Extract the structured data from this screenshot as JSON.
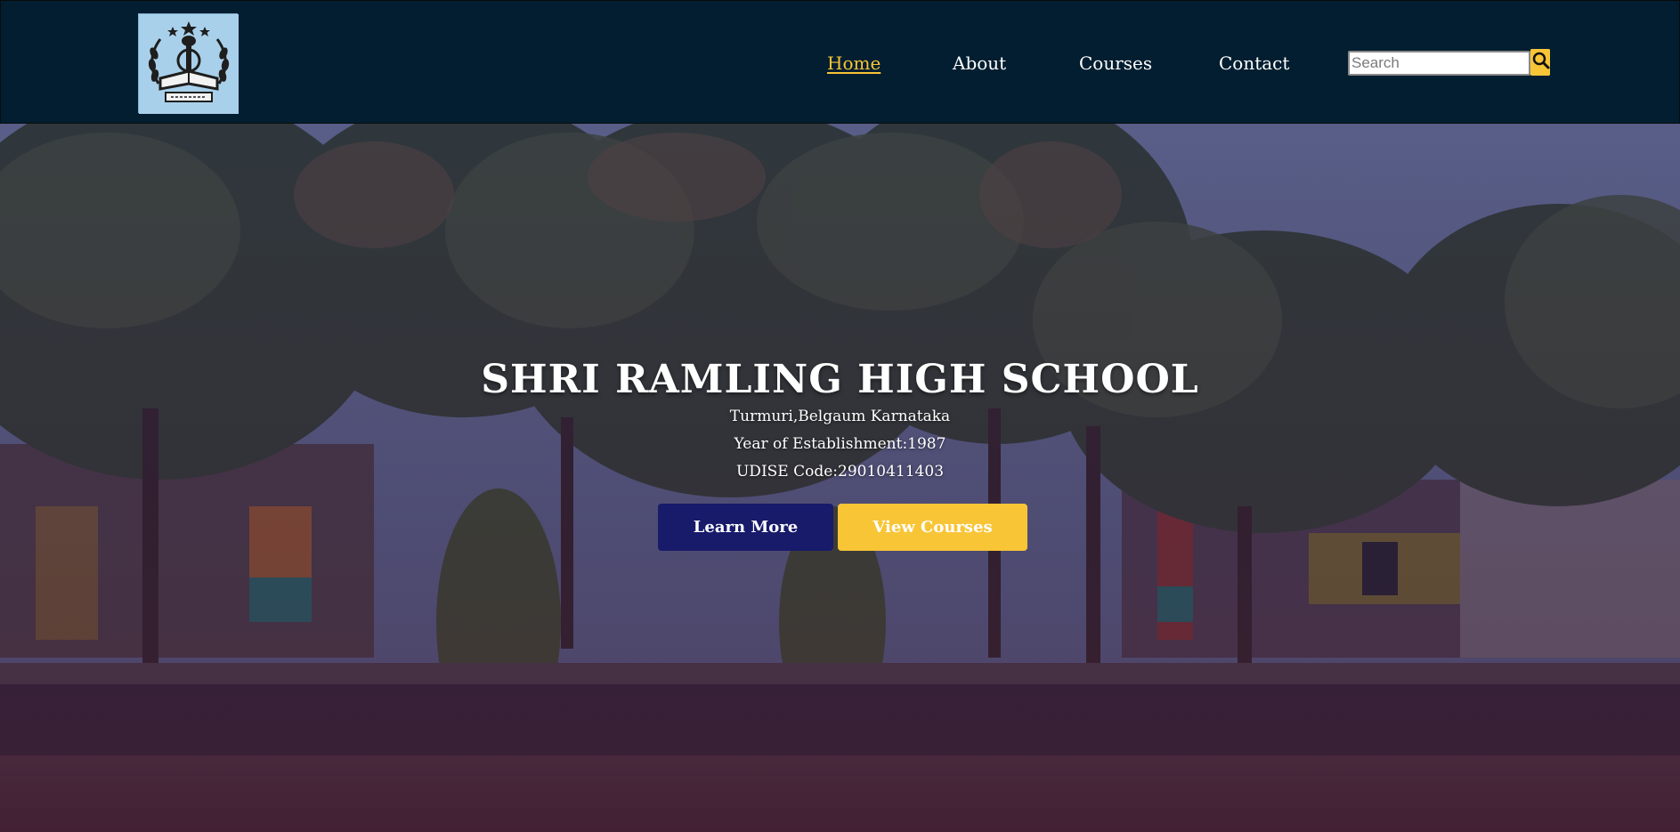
{
  "nav": {
    "logo_icon": "school-crest-icon",
    "items": [
      {
        "label": "Home",
        "active": true
      },
      {
        "label": "About",
        "active": false
      },
      {
        "label": "Courses",
        "active": false
      },
      {
        "label": "Contact",
        "active": false
      }
    ],
    "search": {
      "placeholder": "Search",
      "value": "",
      "icon": "search-icon"
    }
  },
  "hero": {
    "title": "SHRI RAMLING HIGH SCHOOL",
    "location": "Turmuri,Belgaum Karnataka",
    "establishment": "Year of Establishment:1987",
    "udise": "UDISE Code:29010411403",
    "primary_button": "Learn More",
    "secondary_button": "View Courses"
  },
  "colors": {
    "navbar_bg": "#021e30",
    "accent": "#f8c537",
    "primary_button": "#181a6a",
    "text": "#ffffff"
  }
}
